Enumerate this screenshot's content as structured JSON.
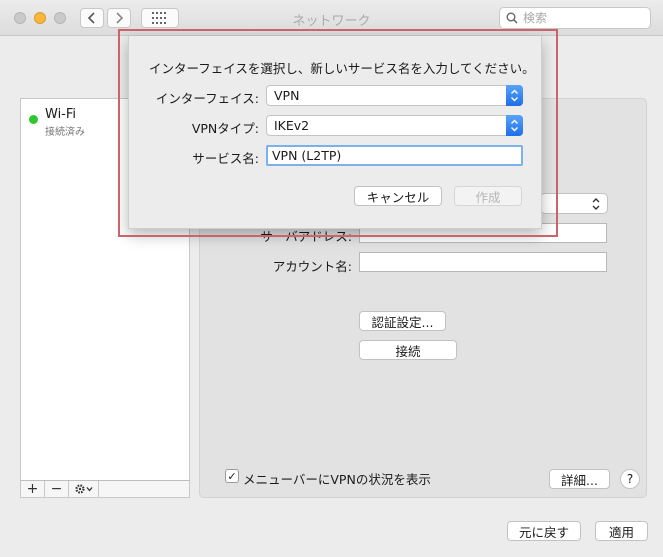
{
  "window": {
    "title": "ネットワーク"
  },
  "toolbar": {
    "search_placeholder": "検索"
  },
  "sidebar": {
    "services": [
      {
        "name": "Wi-Fi",
        "status": "接続済み",
        "status_color": "#2ec82e"
      }
    ],
    "tools": {
      "add": "+",
      "remove": "−"
    }
  },
  "details": {
    "server_address_label": "サーバアドレス:",
    "server_address_value": "",
    "account_name_label": "アカウント名:",
    "account_name_value": "",
    "auth_settings_button": "認証設定...",
    "connect_button": "接続",
    "show_vpn_status_checkbox": {
      "label": "メニューバーにVPNの状況を表示",
      "checked": true
    },
    "advanced_button": "詳細...",
    "help_button": "?"
  },
  "footer": {
    "revert_button": "元に戻す",
    "apply_button": "適用"
  },
  "sheet": {
    "prompt": "インターフェイスを選択し、新しいサービス名を入力してください。",
    "interface_label": "インターフェイス:",
    "interface_value": "VPN",
    "vpn_type_label": "VPNタイプ:",
    "vpn_type_value": "IKEv2",
    "service_name_label": "サービス名:",
    "service_name_value": "VPN (L2TP)",
    "cancel_button": "キャンセル",
    "create_button": "作成"
  },
  "colors": {
    "accent": "#1e6fe8",
    "highlight_box": "#c9646a",
    "focus_ring": "#7ab1ee"
  }
}
